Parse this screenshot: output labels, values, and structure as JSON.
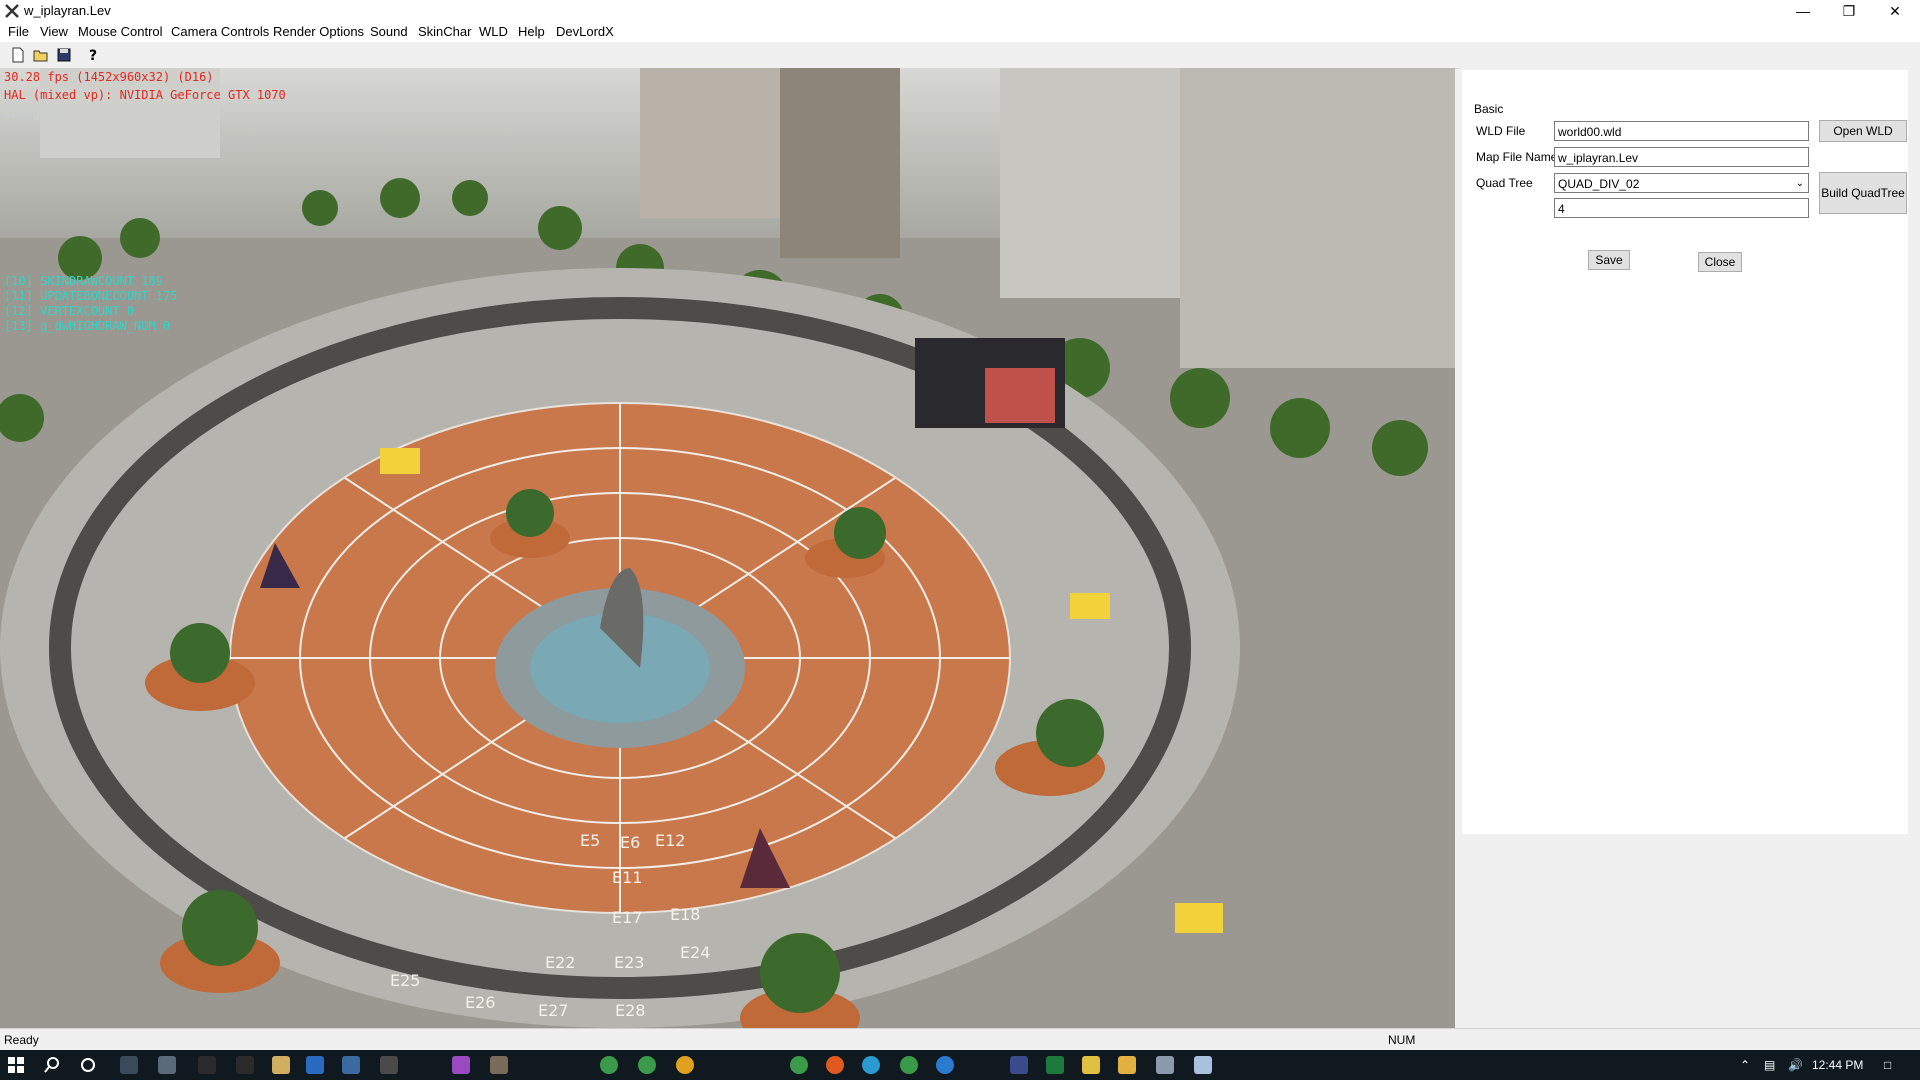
{
  "window": {
    "title": "w_iplayran.Lev"
  },
  "menu": [
    "File",
    "View",
    "Mouse Control",
    "Camera Controls",
    "Render Options",
    "Sound",
    "SkinChar",
    "WLD",
    "Help",
    "DevLordX"
  ],
  "toolbar": {
    "icons": [
      "new-file-icon",
      "open-folder-icon",
      "save-icon",
      "help-icon"
    ]
  },
  "viewport": {
    "fps": "30.28 fps (1452x960x32) (D16)",
    "hal": "HAL (mixed vp): NVIDIA GeForce GTX 1070",
    "changed": "Changed : 0",
    "stats": [
      "[10] SKINDRAWCOUNT 189",
      "[11] UPDATEBONECOUNT 175",
      "[12] VERTEXCOUNT 0",
      "[13] g_dwHIGHDRAW_NUM 0"
    ],
    "grid_labels": [
      "E5",
      "E6",
      "E11",
      "E12",
      "E17",
      "E18",
      "E22",
      "E23",
      "E24",
      "E25",
      "E26",
      "E27",
      "E28"
    ]
  },
  "panel": {
    "group": "Basic",
    "wld_file_label": "WLD File",
    "wld_file_value": "world00.wld",
    "open_wld": "Open WLD",
    "map_file_label": "Map File Name",
    "map_file_value": "w_iplayran.Lev",
    "quad_tree_label": "Quad Tree",
    "quad_tree_value": "QUAD_DIV_02",
    "quad_tree_level": "4",
    "build_quadtree": "Build QuadTree",
    "save": "Save",
    "close": "Close"
  },
  "status": {
    "left": "Ready",
    "right": "NUM"
  },
  "taskbar": {
    "time": "12:44 PM"
  }
}
